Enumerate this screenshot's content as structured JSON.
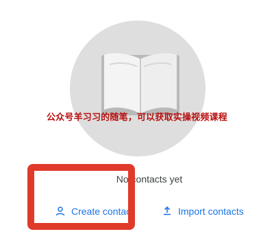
{
  "empty_state": {
    "message": "No contacts yet"
  },
  "actions": {
    "create_label": "Create contact",
    "import_label": "Import contacts",
    "create_icon": "person-outline-icon",
    "import_icon": "upload-icon"
  },
  "overlay": {
    "watermark_text": "公众号羊习习的随笔，可以获取实操视频课程",
    "highlight_color": "#e03a2a"
  },
  "colors": {
    "accent": "#1a73e8",
    "illustration_circle": "#dedede"
  }
}
